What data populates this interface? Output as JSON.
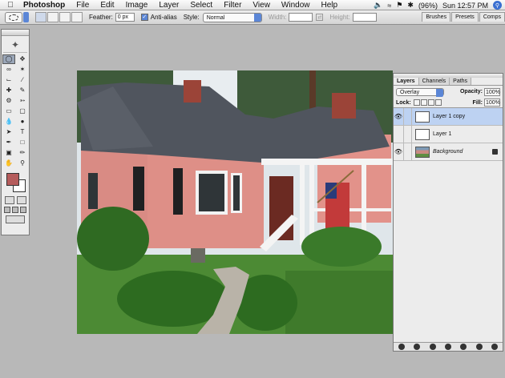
{
  "menubar": {
    "app_name": "Photoshop",
    "menus": [
      "File",
      "Edit",
      "Image",
      "Layer",
      "Select",
      "Filter",
      "View",
      "Window",
      "Help"
    ],
    "battery": "(96%)",
    "clock": "Sun 12:57 PM"
  },
  "options": {
    "feather_label": "Feather:",
    "feather_value": "0 px",
    "antialias_label": "Anti-alias",
    "style_label": "Style:",
    "style_value": "Normal",
    "width_label": "Width:",
    "height_label": "Height:",
    "well_tabs": [
      "Brushes",
      "Presets",
      "Comps"
    ]
  },
  "layers_panel": {
    "tabs": [
      "Layers",
      "Channels",
      "Paths"
    ],
    "blend_mode": "Overlay",
    "opacity_label": "Opacity:",
    "opacity_value": "100%",
    "lock_label": "Lock:",
    "fill_label": "Fill:",
    "fill_value": "100%",
    "layers": [
      {
        "name": "Layer 1 copy",
        "visible": true,
        "selected": true
      },
      {
        "name": "Layer 1",
        "visible": false,
        "selected": false
      },
      {
        "name": "Background",
        "visible": true,
        "selected": false
      }
    ]
  },
  "colors": {
    "foreground": "#b55c5c",
    "background": "#ffffff",
    "selection": "#bdd2f2",
    "accent": "#5b86d6"
  }
}
